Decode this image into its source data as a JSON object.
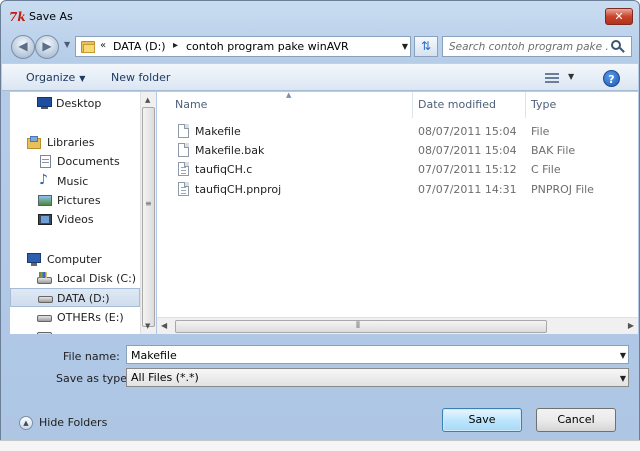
{
  "window": {
    "title": "Save As",
    "app_icon_text": "7k",
    "close_symbol": "✕"
  },
  "address": {
    "overflow_chevron": "«",
    "separator": "▸",
    "crumbs": [
      "DATA (D:)",
      "contoh program pake winAVR"
    ],
    "search_placeholder": "Search contoh program pake ..."
  },
  "toolbar": {
    "organize_label": "Organize",
    "new_folder_label": "New folder",
    "help_symbol": "?"
  },
  "nav_pane": {
    "items": [
      {
        "label": "Desktop",
        "icon": "desktop-icon"
      },
      {
        "label": "Libraries",
        "icon": "libraries-icon"
      },
      {
        "label": "Documents",
        "icon": "documents-icon"
      },
      {
        "label": "Music",
        "icon": "music-icon"
      },
      {
        "label": "Pictures",
        "icon": "pictures-icon"
      },
      {
        "label": "Videos",
        "icon": "videos-icon"
      },
      {
        "label": "Computer",
        "icon": "computer-icon"
      },
      {
        "label": "Local Disk (C:)",
        "icon": "local-disk-icon"
      },
      {
        "label": "DATA (D:)",
        "icon": "drive-icon",
        "selected": true
      },
      {
        "label": "OTHERs (E:)",
        "icon": "drive-icon"
      }
    ]
  },
  "file_list": {
    "columns": [
      "Name",
      "Date modified",
      "Type"
    ],
    "rows": [
      {
        "name": "Makefile",
        "date": "08/07/2011 15:04",
        "type": "File"
      },
      {
        "name": "Makefile.bak",
        "date": "08/07/2011 15:04",
        "type": "BAK File"
      },
      {
        "name": "taufiqCH.c",
        "date": "07/07/2011 15:12",
        "type": "C File"
      },
      {
        "name": "taufiqCH.pnproj",
        "date": "07/07/2011 14:31",
        "type": "PNPROJ File"
      }
    ]
  },
  "form": {
    "file_name_label": "File name:",
    "file_name_value": "Makefile",
    "save_type_label": "Save as type:",
    "save_type_value": "All Files (*.*)"
  },
  "footer": {
    "hide_folders_label": "Hide Folders",
    "save_label": "Save",
    "cancel_label": "Cancel"
  },
  "colors": {
    "frame": "#b6cde8",
    "accent": "#1d58b4",
    "close": "#c9432d"
  }
}
